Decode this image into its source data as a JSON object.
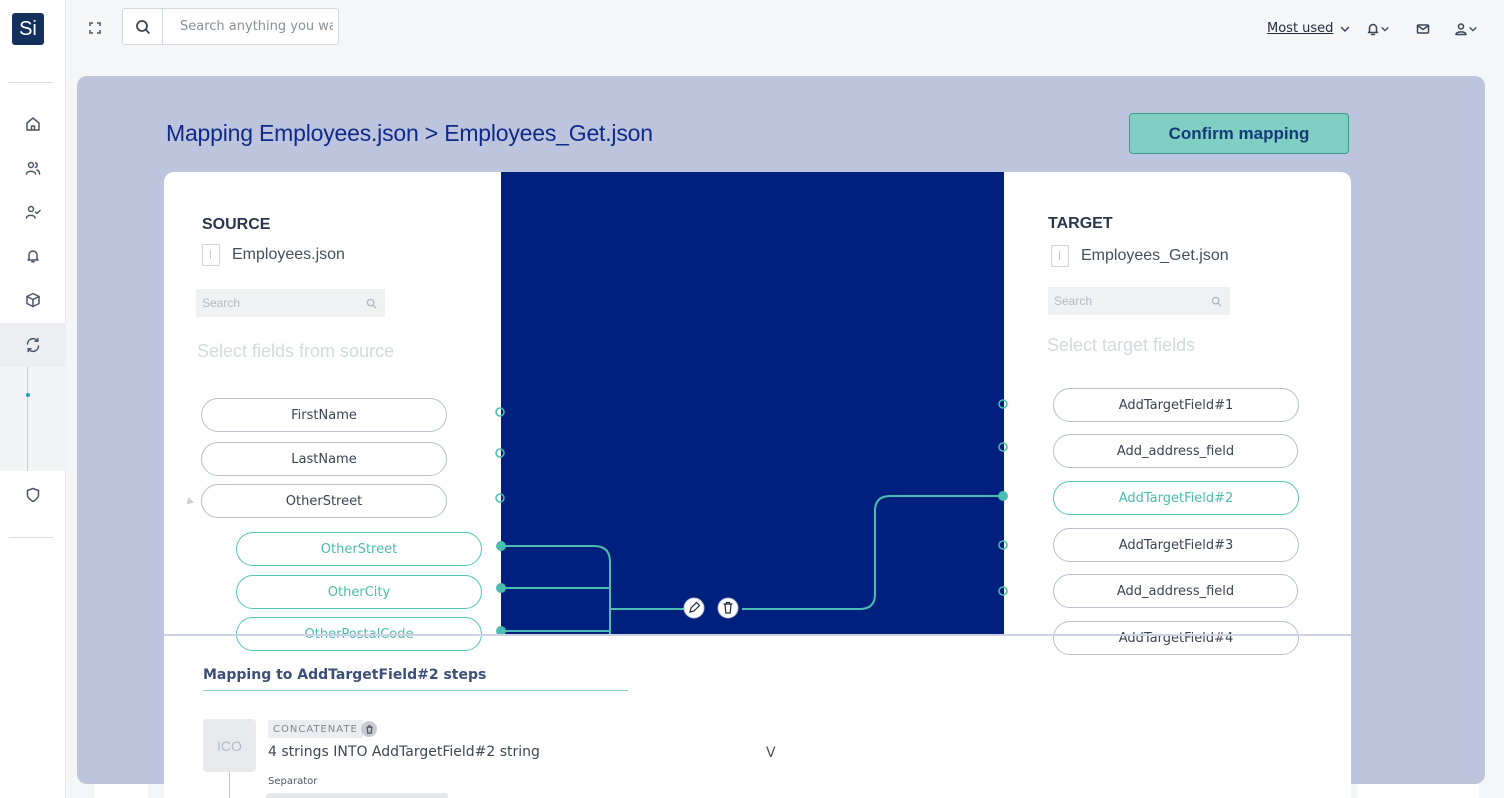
{
  "app": {
    "logo_text": "Si"
  },
  "topbar": {
    "search_placeholder": "Search anything you wa",
    "most_used_label": "Most used",
    "icons": [
      "expand-icon",
      "search-icon",
      "chevron-down-icon",
      "bell-icon",
      "mail-icon",
      "user-icon"
    ]
  },
  "sidebar": {
    "items": [
      {
        "name": "home-icon"
      },
      {
        "name": "users-icon"
      },
      {
        "name": "user-check-icon"
      },
      {
        "name": "bell-icon"
      },
      {
        "name": "cube-icon"
      },
      {
        "name": "sync-icon",
        "active": true
      },
      {
        "name": "shield-icon"
      }
    ]
  },
  "page": {
    "title": "Mapping Employees.json > Employees_Get.json",
    "confirm_label": "Confirm mapping"
  },
  "source": {
    "heading": "SOURCE",
    "file_name": "Employees.json",
    "search_placeholder": "Search",
    "hint": "Select fields from source",
    "fields": [
      "FirstName",
      "LastName",
      "OtherStreet"
    ],
    "sub_fields": [
      "OtherStreet",
      "OtherCity",
      "OtherPostalCode"
    ]
  },
  "target": {
    "heading": "TARGET",
    "file_name": "Employees_Get.json",
    "search_placeholder": "Search",
    "hint": "Select target fields",
    "fields": [
      "AddTargetField#1",
      "Add_address_field",
      "AddTargetField#2",
      "AddTargetField#3",
      "Add_address_field",
      "AddTargetField#4"
    ],
    "selected_index": 2
  },
  "steps": {
    "title": "Mapping to AddTargetField#2 steps",
    "icon_placeholder": "ICO",
    "operation_badge": "CONCATENATE",
    "operation_desc": "4 strings INTO AddTargetField#2 string",
    "chevron": "V",
    "separator_label": "Separator"
  },
  "colors": {
    "accent_teal": "#55c3b6",
    "mapping_blue": "#00207d",
    "panel_bg": "#bdc4de",
    "title_blue": "#102a8a",
    "confirm_bg": "#7fd0c2"
  }
}
